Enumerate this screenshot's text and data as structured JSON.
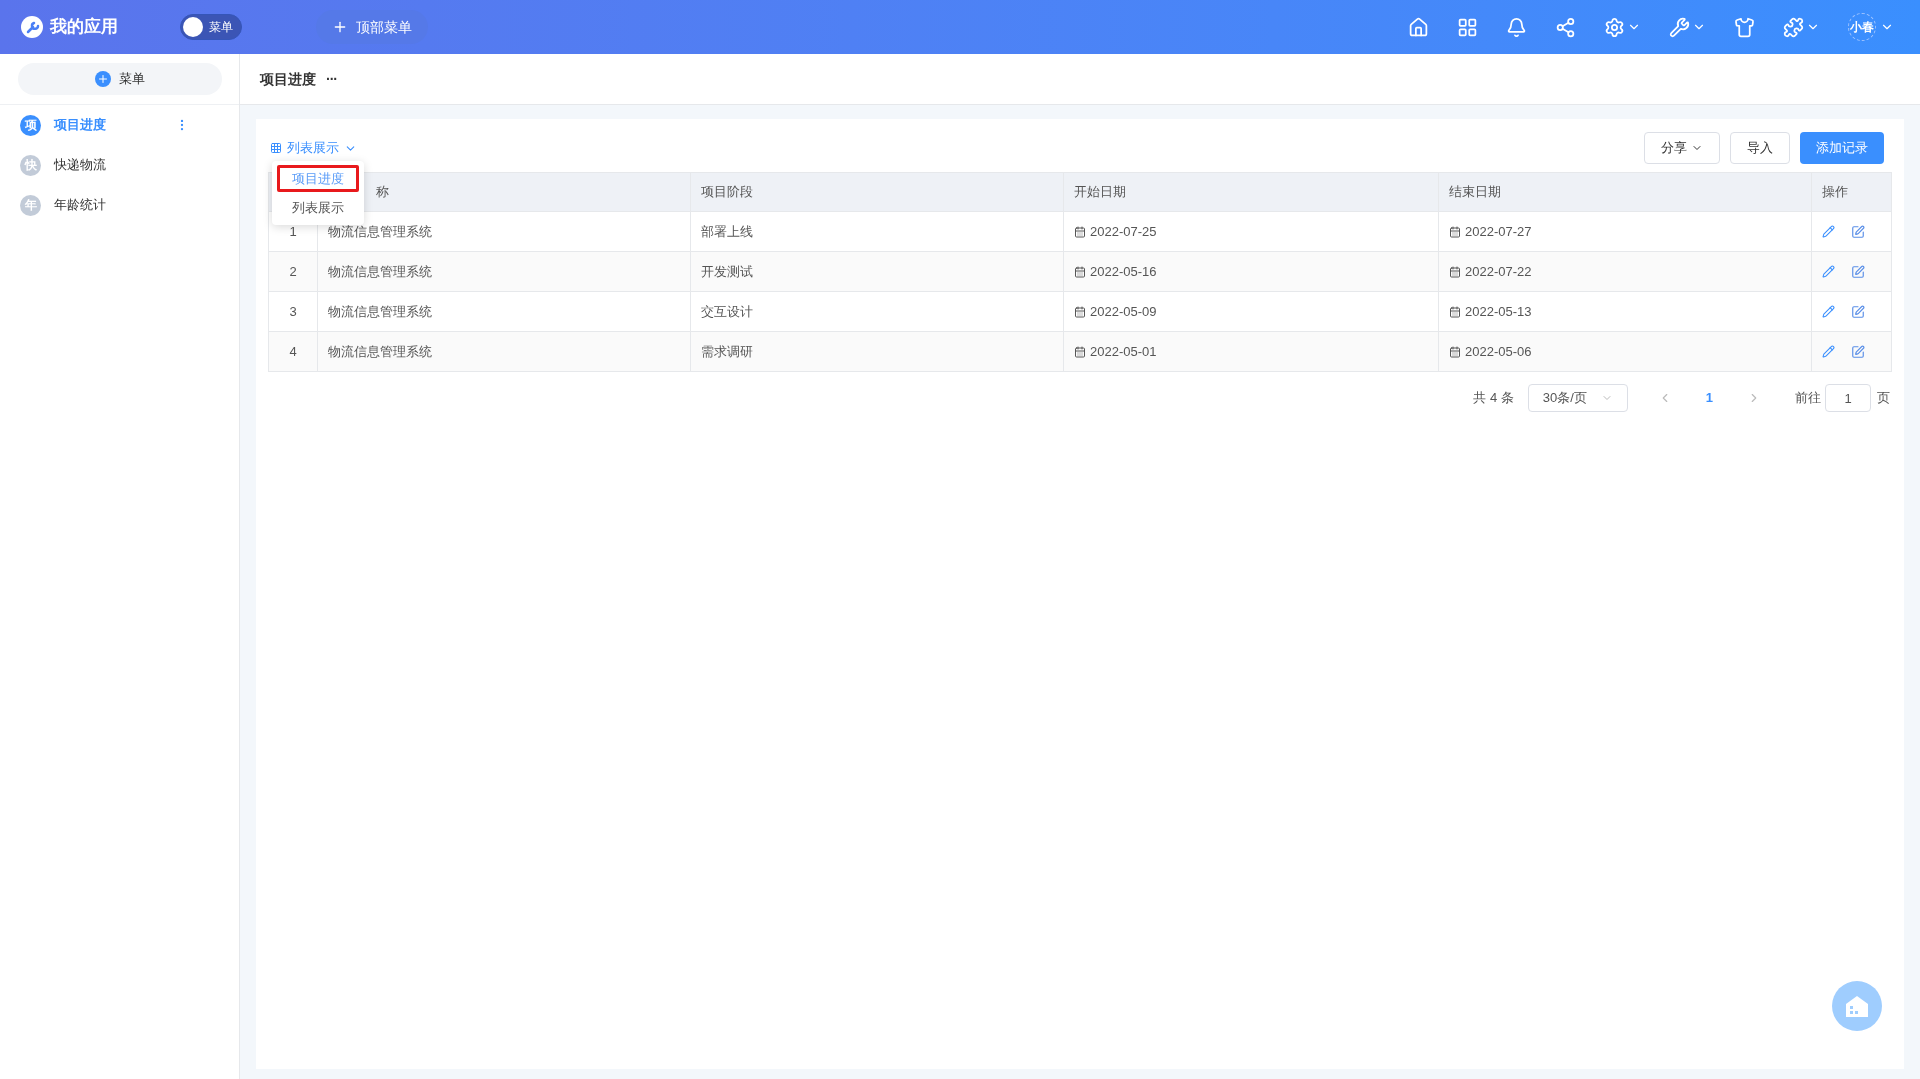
{
  "app": {
    "title": "我的应用"
  },
  "menu_toggle": {
    "label": "菜单",
    "on": false
  },
  "top_menu_button": {
    "label": "顶部菜单"
  },
  "user": {
    "name": "小春"
  },
  "sidebar": {
    "add_button": "菜单",
    "items": [
      {
        "badge": "项",
        "label": "项目进度",
        "selected": true
      },
      {
        "badge": "快",
        "label": "快递物流",
        "selected": false
      },
      {
        "badge": "年",
        "label": "年龄统计",
        "selected": false
      }
    ]
  },
  "page_title": "项目进度",
  "page_more": "···",
  "view_switch": {
    "label": "列表展示",
    "expanded": true,
    "options": [
      {
        "label": "项目进度",
        "selected": true
      },
      {
        "label": "列表展示",
        "selected": false
      }
    ]
  },
  "toolbar": {
    "share": "分享",
    "import": "导入",
    "add": "添加记录"
  },
  "table": {
    "columns": [
      "",
      "称",
      "项目阶段",
      "开始日期",
      "结束日期",
      "操作"
    ],
    "rows": [
      {
        "index": "1",
        "name": "物流信息管理系统",
        "stage": "部署上线",
        "start": "2022-07-25",
        "end": "2022-07-27"
      },
      {
        "index": "2",
        "name": "物流信息管理系统",
        "stage": "开发测试",
        "start": "2022-05-16",
        "end": "2022-07-22"
      },
      {
        "index": "3",
        "name": "物流信息管理系统",
        "stage": "交互设计",
        "start": "2022-05-09",
        "end": "2022-05-13"
      },
      {
        "index": "4",
        "name": "物流信息管理系统",
        "stage": "需求调研",
        "start": "2022-05-01",
        "end": "2022-05-06"
      }
    ]
  },
  "pagination": {
    "total": "共 4 条",
    "page_size": "30条/页",
    "pages": [
      {
        "label": "1",
        "selected": true
      }
    ],
    "goto_label": "前往",
    "goto_value": "1",
    "page_suffix": "页"
  }
}
